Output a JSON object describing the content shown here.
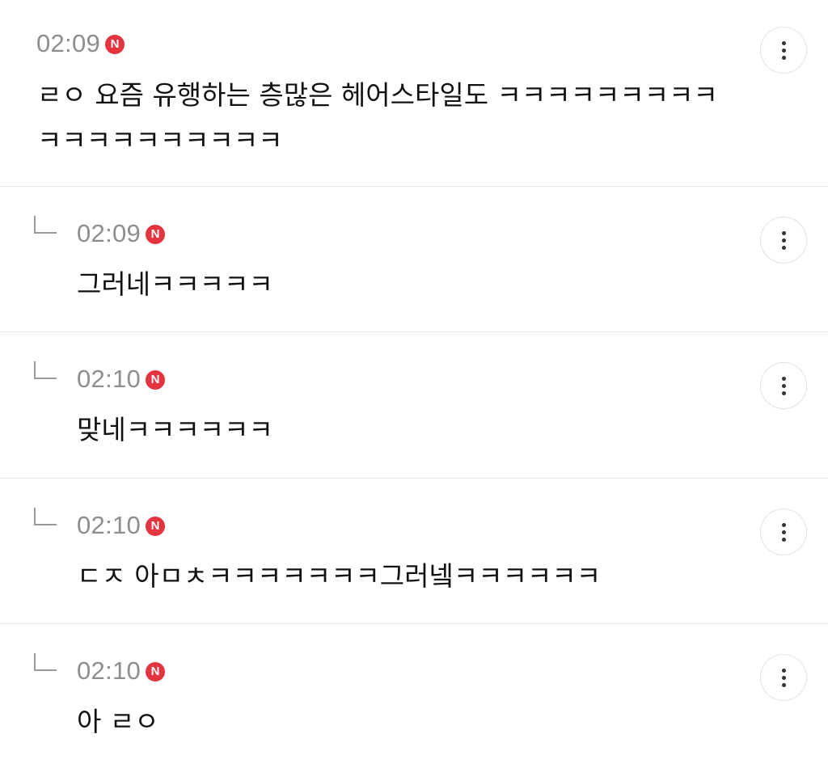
{
  "comments": [
    {
      "time": "02:09",
      "badge": "N",
      "text": "ㄹㅇ 요즘 유행하는 층많은 헤어스타일도 ㅋㅋㅋㅋㅋㅋㅋㅋㅋㅋㅋㅋㅋㅋㅋㅋㅋㅋㅋ",
      "is_reply": false
    },
    {
      "time": "02:09",
      "badge": "N",
      "text": "그러네ㅋㅋㅋㅋㅋ",
      "is_reply": true
    },
    {
      "time": "02:10",
      "badge": "N",
      "text": "맞네ㅋㅋㅋㅋㅋㅋ",
      "is_reply": true
    },
    {
      "time": "02:10",
      "badge": "N",
      "text": "ㄷㅈ 아ㅁㅊㅋㅋㅋㅋㅋㅋㅋ그러넼ㅋㅋㅋㅋㅋㅋ",
      "is_reply": true
    },
    {
      "time": "02:10",
      "badge": "N",
      "text": "아 ㄹㅇ",
      "is_reply": true
    }
  ],
  "icons": {
    "reply": "reply-arrow-icon",
    "more": "more-vertical-icon",
    "new": "new-badge-icon"
  },
  "colors": {
    "badge": "#e3343f",
    "time": "#8e8e8e",
    "divider": "#e6e6e6"
  }
}
